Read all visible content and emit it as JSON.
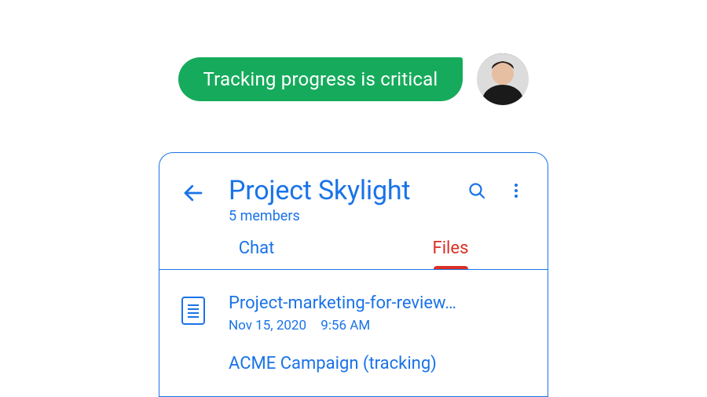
{
  "chat": {
    "message": "Tracking progress is critical"
  },
  "room": {
    "title": "Project Skylight",
    "members_label": "5 members"
  },
  "tabs": {
    "chat": "Chat",
    "files": "Files"
  },
  "files": [
    {
      "name": "Project-marketing-for-review…",
      "date": "Nov 15, 2020",
      "time": "9:56 AM"
    },
    {
      "name": "ACME Campaign (tracking)",
      "date": "",
      "time": ""
    }
  ]
}
